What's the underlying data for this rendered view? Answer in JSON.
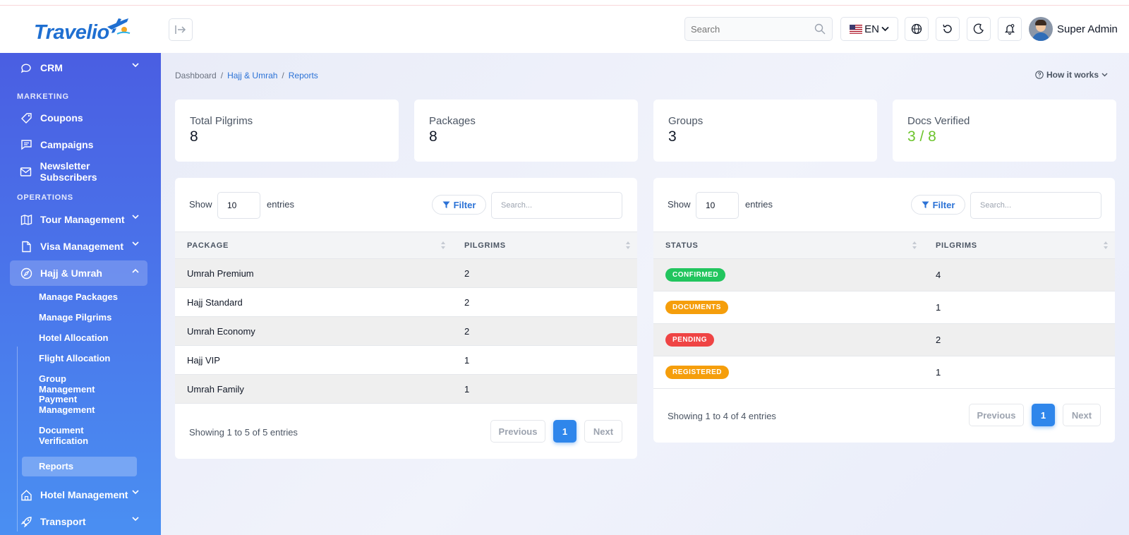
{
  "app": {
    "logo_text": "Travelio"
  },
  "header": {
    "search_placeholder": "Search",
    "language": "EN",
    "user_name": "Super Admin"
  },
  "sidebar": {
    "crm": "CRM",
    "marketing_label": "MARKETING",
    "coupons": "Coupons",
    "campaigns": "Campaigns",
    "newsletter": "Newsletter Subscribers",
    "operations_label": "OPERATIONS",
    "tour": "Tour Management",
    "visa": "Visa Management",
    "hajj": "Hajj & Umrah",
    "sub": {
      "manage_packages": "Manage Packages",
      "manage_pilgrims": "Manage Pilgrims",
      "hotel_allocation": "Hotel Allocation",
      "flight_allocation": "Flight Allocation",
      "group_management": "Group Management",
      "payment_management": "Payment Management",
      "document_verification": "Document Verification",
      "reports": "Reports"
    },
    "hotel": "Hotel Management",
    "transport": "Transport"
  },
  "breadcrumb": {
    "home": "Dashboard",
    "section": "Hajj & Umrah",
    "current": "Reports",
    "separator": "/"
  },
  "how_it_works": "How it works",
  "stats": [
    {
      "label": "Total Pilgrims",
      "value": "8"
    },
    {
      "label": "Packages",
      "value": "8"
    },
    {
      "label": "Groups",
      "value": "3"
    },
    {
      "label": "Docs Verified",
      "value": "3 / 8"
    }
  ],
  "table_controls": {
    "show": "Show",
    "entries_value": "10",
    "entries": "entries",
    "filter": "Filter",
    "search_placeholder": "Search..."
  },
  "package_table": {
    "headers": [
      "PACKAGE",
      "PILGRIMS"
    ],
    "rows": [
      {
        "package": "Umrah Premium",
        "pilgrims": "2"
      },
      {
        "package": "Hajj Standard",
        "pilgrims": "2"
      },
      {
        "package": "Umrah Economy",
        "pilgrims": "2"
      },
      {
        "package": "Hajj VIP",
        "pilgrims": "1"
      },
      {
        "package": "Umrah Family",
        "pilgrims": "1"
      }
    ],
    "showing": "Showing 1 to 5 of 5 entries"
  },
  "status_table": {
    "headers": [
      "STATUS",
      "PILGRIMS"
    ],
    "rows": [
      {
        "status": "CONFIRMED",
        "color": "#22c55e",
        "pilgrims": "4"
      },
      {
        "status": "DOCUMENTS",
        "color": "#f59e0b",
        "pilgrims": "1"
      },
      {
        "status": "PENDING",
        "color": "#ef4444",
        "pilgrims": "2"
      },
      {
        "status": "REGISTERED",
        "color": "#f59e0b",
        "pilgrims": "1"
      }
    ],
    "showing": "Showing 1 to 4 of 4 entries"
  },
  "pagination": {
    "previous": "Previous",
    "current": "1",
    "next": "Next"
  },
  "colors": {
    "accent": "#2f86eb",
    "sidebar_top": "#4a5ee2",
    "sidebar_bottom": "#4a8ff2",
    "verified": "#6cc42c"
  }
}
